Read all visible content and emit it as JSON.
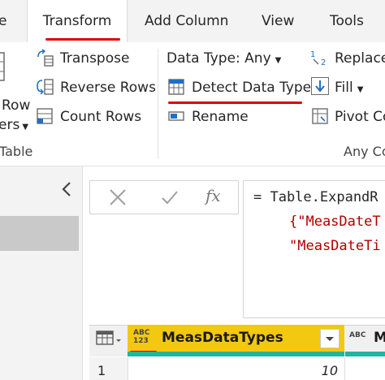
{
  "tabs": [
    {
      "label": "e"
    },
    {
      "label": "Transform"
    },
    {
      "label": "Add Column"
    },
    {
      "label": "View"
    },
    {
      "label": "Tools"
    }
  ],
  "ribbon": {
    "left_items": {
      "row": "Row",
      "ers": "ers"
    },
    "table_group": {
      "transpose": "Transpose",
      "reverse_rows": "Reverse Rows",
      "count_rows": "Count Rows",
      "label": "Table"
    },
    "any_column_group": {
      "data_type": "Data Type: Any",
      "detect_data_type": "Detect Data Type",
      "rename": "Rename",
      "replace": "Replace",
      "fill": "Fill",
      "pivot": "Pivot Co",
      "label": "Any Co"
    }
  },
  "formula_bar": {
    "fx": "fx",
    "line1": "= Table.ExpandR",
    "line2": "{\"MeasDateT",
    "line3": "\"MeasDateTi"
  },
  "grid": {
    "column_type_badge": "ABC 123",
    "column_header": "MeasDataTypes",
    "next_column_badge": "ABC",
    "next_column_prefix": "M",
    "rows": [
      {
        "index": "1",
        "value": "10"
      }
    ]
  },
  "colors": {
    "accent": "#f2c811",
    "underline": "#e00000",
    "quality": "#1fb5a0"
  }
}
